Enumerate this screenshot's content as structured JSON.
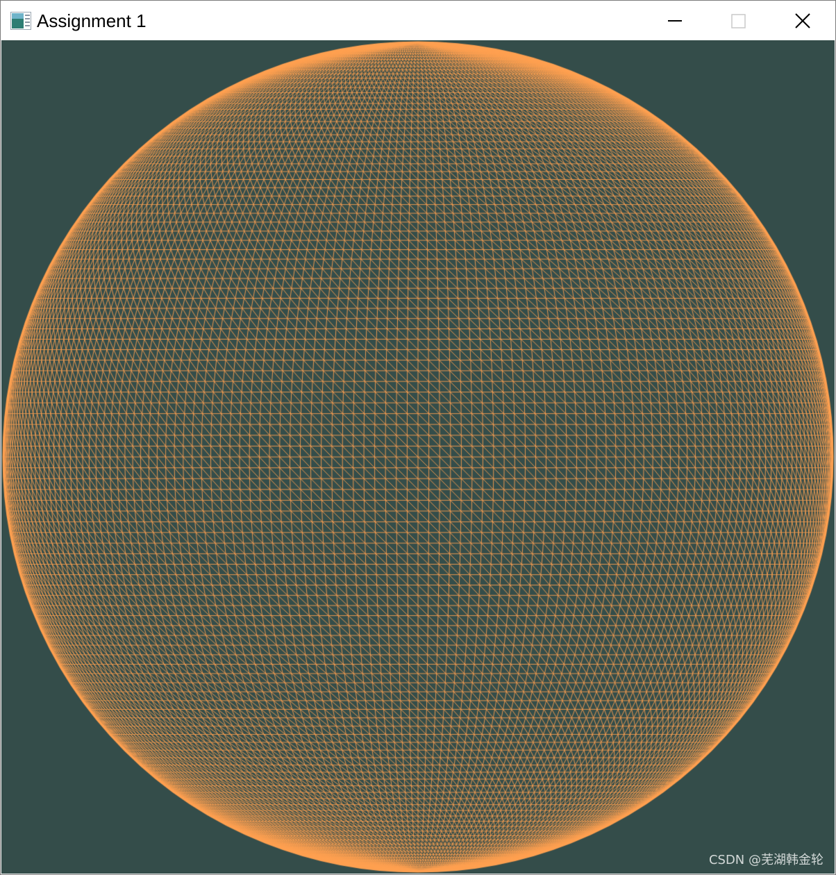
{
  "window": {
    "title": "Assignment 1",
    "icon": "application-window-icon",
    "controls": {
      "minimize_icon": "minimize-icon",
      "maximize_icon": "maximize-icon",
      "close_icon": "close-icon"
    }
  },
  "render": {
    "background_color": "#344d4a",
    "wire_color": "#ffa050",
    "object": "wireframe-sphere"
  },
  "watermark": {
    "text": "CSDN @芜湖韩金轮"
  }
}
